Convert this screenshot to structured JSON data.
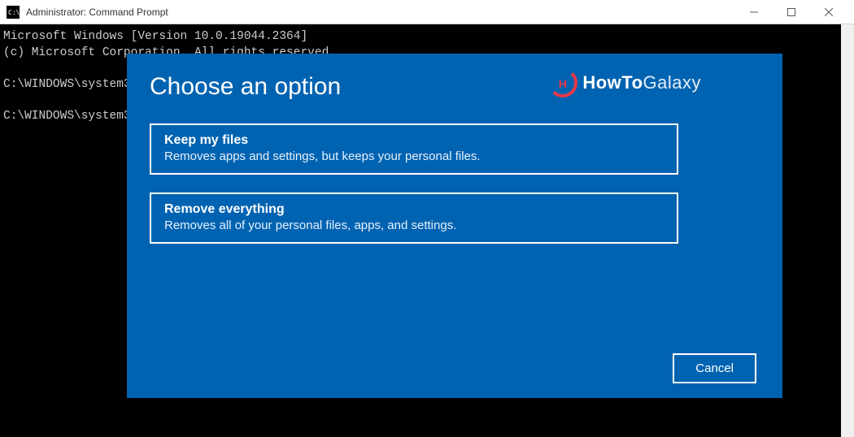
{
  "titlebar": {
    "title": "Administrator: Command Prompt"
  },
  "console": {
    "line1": "Microsoft Windows [Version 10.0.19044.2364]",
    "line2": "(c) Microsoft Corporation. All rights reserved.",
    "line3": "",
    "line4": "C:\\WINDOWS\\system3",
    "line5": "",
    "line6": "C:\\WINDOWS\\system3"
  },
  "dialog": {
    "title": "Choose an option",
    "option1": {
      "title": "Keep my files",
      "desc": "Removes apps and settings, but keeps your personal files."
    },
    "option2": {
      "title": "Remove everything",
      "desc": "Removes all of your personal files, apps, and settings."
    },
    "cancel": "Cancel"
  },
  "watermark": {
    "text1": "HowTo",
    "text2": "Galaxy"
  }
}
